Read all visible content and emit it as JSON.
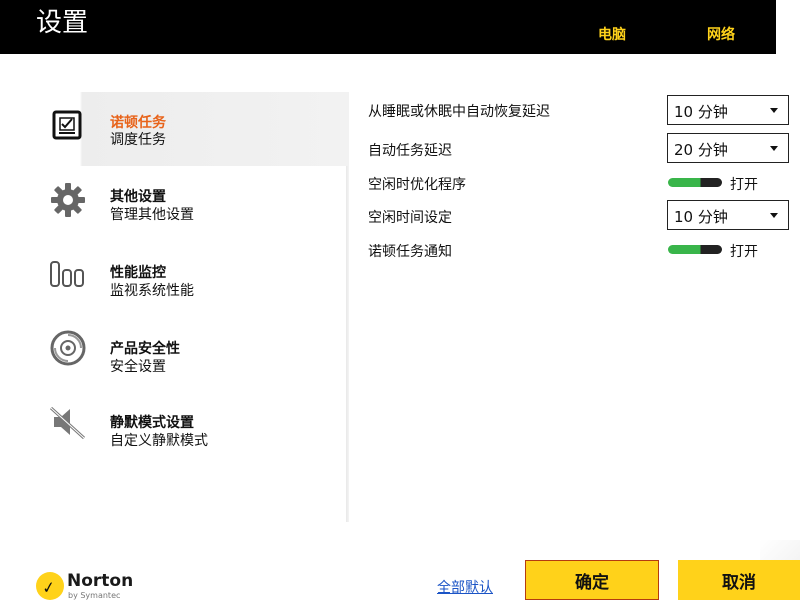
{
  "header": {
    "title": "设置",
    "tabs": [
      {
        "label": "电脑"
      },
      {
        "label": "网络"
      }
    ]
  },
  "colors": {
    "header_bg": "#000000",
    "accent_yellow": "#ffd21a",
    "active_text": "#e8631a",
    "toggle_on": "#39b54a",
    "link": "#1b54c6"
  },
  "sidebar": {
    "items": [
      {
        "title": "诺顿任务",
        "subtitle": "调度任务",
        "icon": "task-checkbox-icon",
        "active": true
      },
      {
        "title": "其他设置",
        "subtitle": "管理其他设置",
        "icon": "gear-icon",
        "active": false
      },
      {
        "title": "性能监控",
        "subtitle": "监视系统性能",
        "icon": "performance-bars-icon",
        "active": false
      },
      {
        "title": "产品安全性",
        "subtitle": "安全设置",
        "icon": "disc-security-icon",
        "active": false
      },
      {
        "title": "静默模式设置",
        "subtitle": "自定义静默模式",
        "icon": "mute-speaker-icon",
        "active": false
      }
    ]
  },
  "settings": [
    {
      "label": "从睡眠或休眠中自动恢复延迟",
      "control": "dropdown",
      "value": "10 分钟"
    },
    {
      "label": "自动任务延迟",
      "control": "dropdown",
      "value": "20 分钟"
    },
    {
      "label": "空闲时优化程序",
      "control": "toggle",
      "state": "打开"
    },
    {
      "label": "空闲时间设定",
      "control": "dropdown",
      "value": "10 分钟"
    },
    {
      "label": "诺顿任务通知",
      "control": "toggle",
      "state": "打开"
    }
  ],
  "footer": {
    "logo_name": "Norton",
    "logo_sub": "by Symantec",
    "reset_link": "全部默认",
    "ok_label": "确定",
    "cancel_label": "取消"
  }
}
